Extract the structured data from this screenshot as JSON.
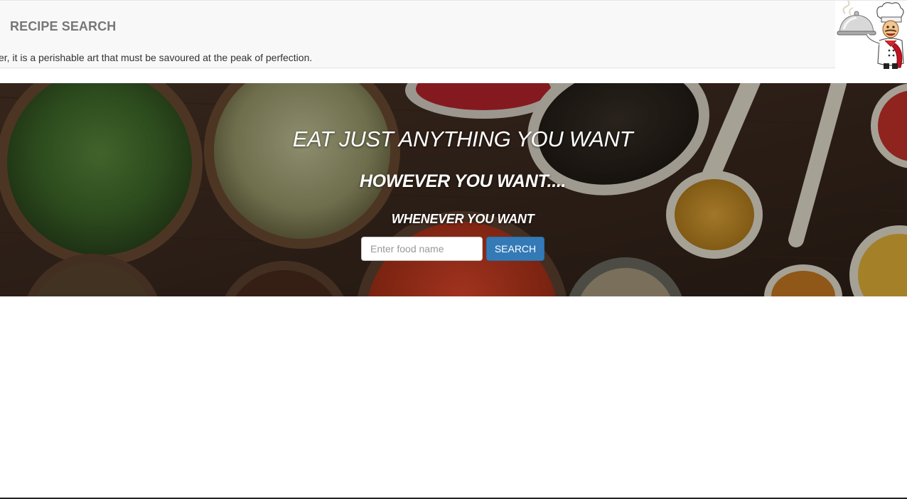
{
  "navbar": {
    "brand": "RECIPE SEARCH",
    "marquee": "er, it is a perishable art that must be savoured at the peak of perfection.",
    "logo_icon": "chef-with-cloche-icon"
  },
  "hero": {
    "headline": "EAT JUST ANYTHING YOU WANT",
    "subheadline": "HOWEVER YOU WANT....",
    "tagline": "WHENEVER YOU WANT",
    "background": "spices-in-bowls-and-spoons"
  },
  "search": {
    "placeholder": "Enter food name",
    "value": "",
    "button_label": "SEARCH"
  },
  "colors": {
    "navbar_bg": "#f8f8f8",
    "brand_text": "#777777",
    "button_primary": "#337ab7",
    "hero_text": "#ffffff"
  }
}
